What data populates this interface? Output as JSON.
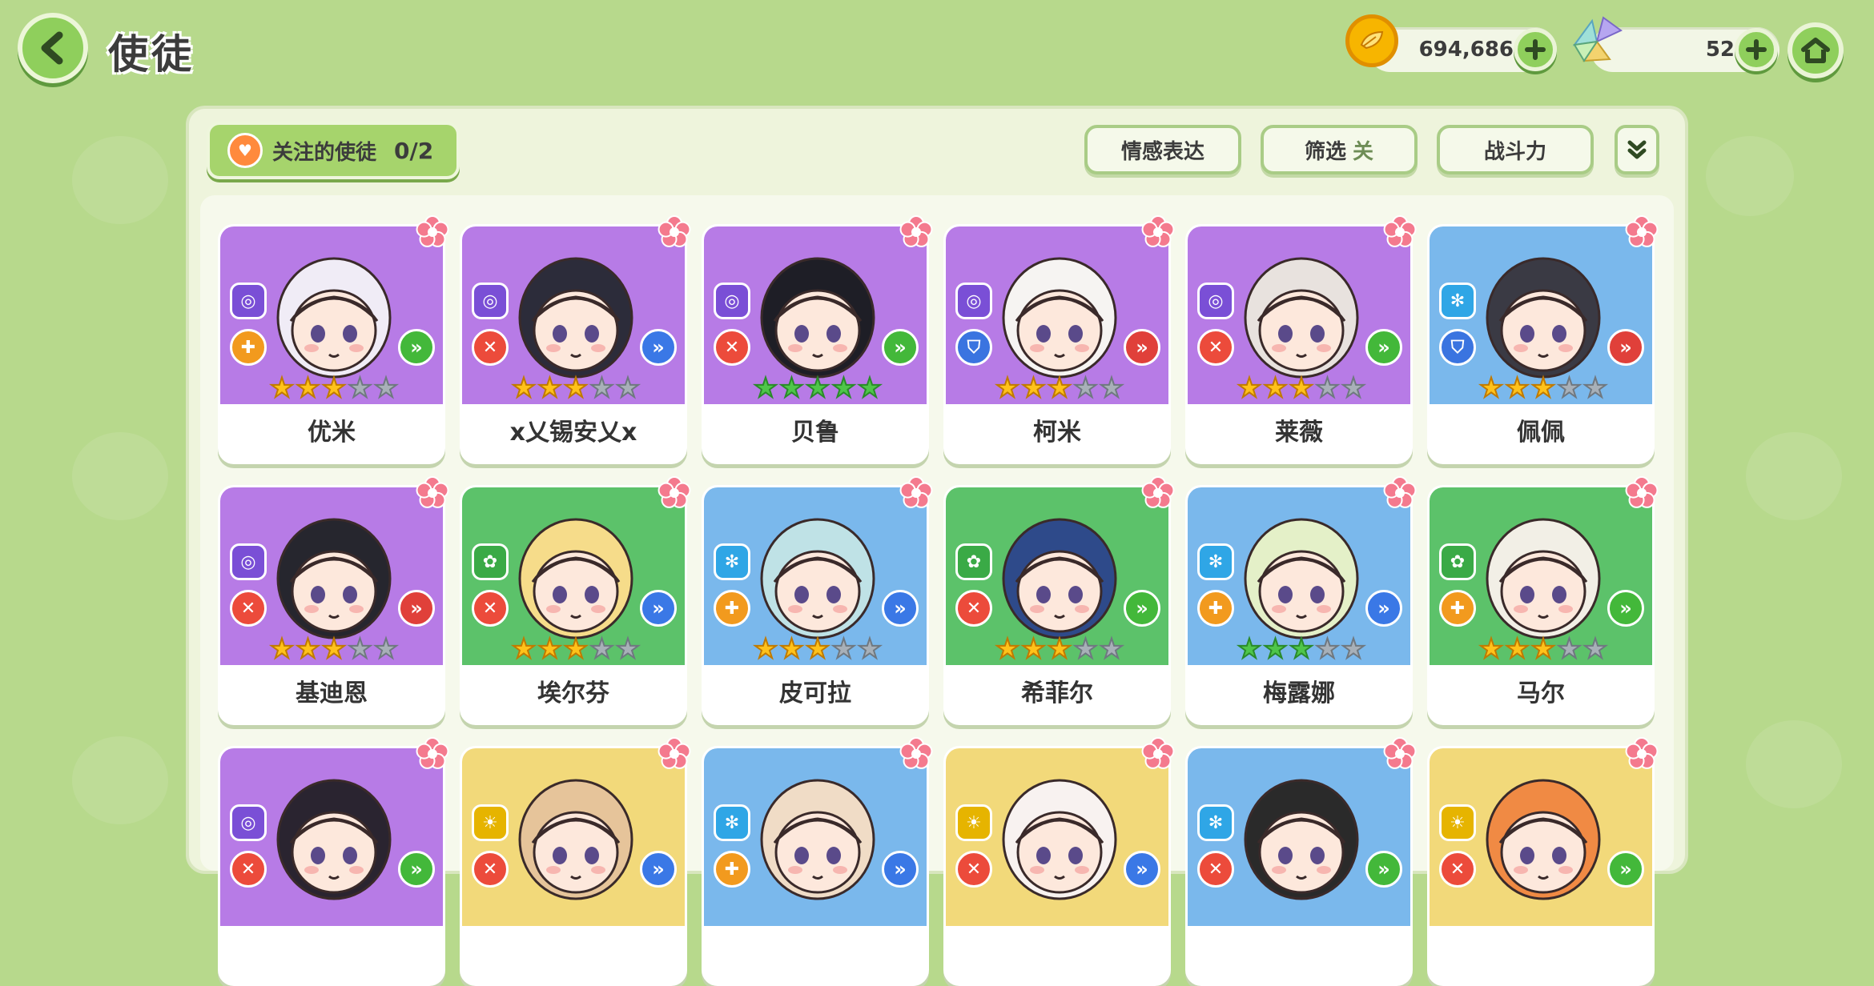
{
  "header": {
    "title": "使徒",
    "gold": "694,686",
    "gems": "52"
  },
  "colors": {
    "background": "#b7d98c",
    "purple": "#b77be6",
    "green": "#5cc26a",
    "blue": "#7ab8ec",
    "yellow": "#f2d97a",
    "gold_star": "#ffc21a",
    "green_star": "#4fc64a",
    "gray_star": "#a8b0b8"
  },
  "toolbar": {
    "favorites_label": "关注的使徒",
    "favorites_count": "0/2",
    "emotion_label": "情感表达",
    "filter_label": "筛选",
    "filter_state": "关",
    "power_label": "战斗力"
  },
  "characters": [
    {
      "name": "优米",
      "bg": "purple",
      "element": "vortex",
      "role": "heal",
      "type": "green-arrow",
      "stars": 3,
      "star_color": "gold"
    },
    {
      "name": "x乂锡安乂x",
      "bg": "purple",
      "element": "vortex",
      "role": "attack",
      "type": "blue-arrow",
      "stars": 3,
      "star_color": "gold"
    },
    {
      "name": "贝鲁",
      "bg": "purple",
      "element": "vortex",
      "role": "attack",
      "type": "green-arrow",
      "stars": 5,
      "star_color": "green"
    },
    {
      "name": "柯米",
      "bg": "purple",
      "element": "vortex",
      "role": "defense",
      "type": "red-arrow",
      "stars": 3,
      "star_color": "gold"
    },
    {
      "name": "莱薇",
      "bg": "purple",
      "element": "vortex",
      "role": "attack",
      "type": "green-arrow",
      "stars": 3,
      "star_color": "gold"
    },
    {
      "name": "佩佩",
      "bg": "blue",
      "element": "frost",
      "role": "defense",
      "type": "red-arrow",
      "stars": 3,
      "star_color": "gold"
    },
    {
      "name": "基迪恩",
      "bg": "purple",
      "element": "vortex",
      "role": "attack",
      "type": "red-arrow",
      "stars": 3,
      "star_color": "gold"
    },
    {
      "name": "埃尔芬",
      "bg": "green",
      "element": "leaf",
      "role": "attack",
      "type": "blue-arrow",
      "stars": 3,
      "star_color": "gold"
    },
    {
      "name": "皮可拉",
      "bg": "blue",
      "element": "frost",
      "role": "heal",
      "type": "blue-arrow",
      "stars": 3,
      "star_color": "gold"
    },
    {
      "name": "希菲尔",
      "bg": "green",
      "element": "leaf",
      "role": "attack",
      "type": "green-arrow",
      "stars": 3,
      "star_color": "gold"
    },
    {
      "name": "梅露娜",
      "bg": "blue",
      "element": "frost",
      "role": "heal",
      "type": "blue-arrow",
      "stars": 3,
      "star_color": "green"
    },
    {
      "name": "马尔",
      "bg": "green",
      "element": "leaf",
      "role": "heal",
      "type": "green-arrow",
      "stars": 3,
      "star_color": "gold"
    },
    {
      "name": "",
      "bg": "purple",
      "element": "vortex",
      "role": "attack",
      "type": "green-arrow",
      "stars": 0,
      "star_color": "gold"
    },
    {
      "name": "",
      "bg": "yellow",
      "element": "sun",
      "role": "attack",
      "type": "blue-arrow",
      "stars": 0,
      "star_color": "gold"
    },
    {
      "name": "",
      "bg": "blue",
      "element": "frost",
      "role": "heal",
      "type": "blue-arrow",
      "stars": 0,
      "star_color": "gold"
    },
    {
      "name": "",
      "bg": "yellow",
      "element": "sun",
      "role": "attack",
      "type": "blue-arrow",
      "stars": 0,
      "star_color": "gold"
    },
    {
      "name": "",
      "bg": "blue",
      "element": "frost",
      "role": "attack",
      "type": "green-arrow",
      "stars": 0,
      "star_color": "gold"
    },
    {
      "name": "",
      "bg": "yellow",
      "element": "sun",
      "role": "attack",
      "type": "green-arrow",
      "stars": 0,
      "star_color": "gold"
    }
  ]
}
